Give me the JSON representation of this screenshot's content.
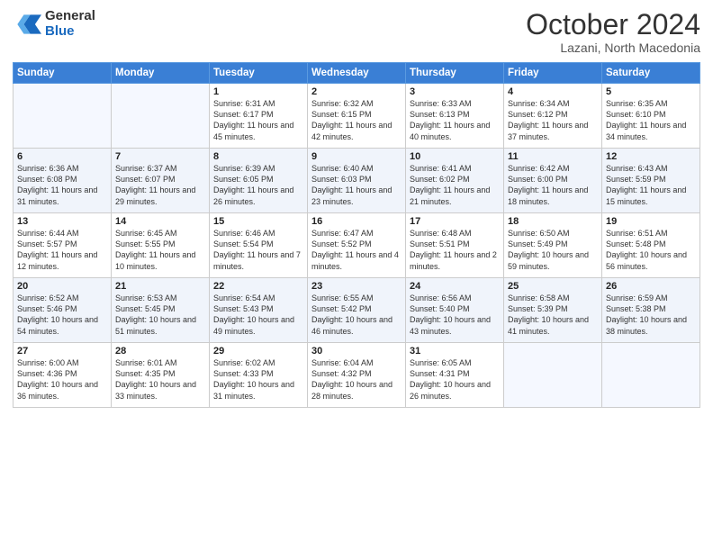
{
  "header": {
    "logo_general": "General",
    "logo_blue": "Blue",
    "month_title": "October 2024",
    "location": "Lazani, North Macedonia"
  },
  "weekdays": [
    "Sunday",
    "Monday",
    "Tuesday",
    "Wednesday",
    "Thursday",
    "Friday",
    "Saturday"
  ],
  "weeks": [
    [
      {
        "day": "",
        "info": ""
      },
      {
        "day": "",
        "info": ""
      },
      {
        "day": "1",
        "info": "Sunrise: 6:31 AM\nSunset: 6:17 PM\nDaylight: 11 hours and 45 minutes."
      },
      {
        "day": "2",
        "info": "Sunrise: 6:32 AM\nSunset: 6:15 PM\nDaylight: 11 hours and 42 minutes."
      },
      {
        "day": "3",
        "info": "Sunrise: 6:33 AM\nSunset: 6:13 PM\nDaylight: 11 hours and 40 minutes."
      },
      {
        "day": "4",
        "info": "Sunrise: 6:34 AM\nSunset: 6:12 PM\nDaylight: 11 hours and 37 minutes."
      },
      {
        "day": "5",
        "info": "Sunrise: 6:35 AM\nSunset: 6:10 PM\nDaylight: 11 hours and 34 minutes."
      }
    ],
    [
      {
        "day": "6",
        "info": "Sunrise: 6:36 AM\nSunset: 6:08 PM\nDaylight: 11 hours and 31 minutes."
      },
      {
        "day": "7",
        "info": "Sunrise: 6:37 AM\nSunset: 6:07 PM\nDaylight: 11 hours and 29 minutes."
      },
      {
        "day": "8",
        "info": "Sunrise: 6:39 AM\nSunset: 6:05 PM\nDaylight: 11 hours and 26 minutes."
      },
      {
        "day": "9",
        "info": "Sunrise: 6:40 AM\nSunset: 6:03 PM\nDaylight: 11 hours and 23 minutes."
      },
      {
        "day": "10",
        "info": "Sunrise: 6:41 AM\nSunset: 6:02 PM\nDaylight: 11 hours and 21 minutes."
      },
      {
        "day": "11",
        "info": "Sunrise: 6:42 AM\nSunset: 6:00 PM\nDaylight: 11 hours and 18 minutes."
      },
      {
        "day": "12",
        "info": "Sunrise: 6:43 AM\nSunset: 5:59 PM\nDaylight: 11 hours and 15 minutes."
      }
    ],
    [
      {
        "day": "13",
        "info": "Sunrise: 6:44 AM\nSunset: 5:57 PM\nDaylight: 11 hours and 12 minutes."
      },
      {
        "day": "14",
        "info": "Sunrise: 6:45 AM\nSunset: 5:55 PM\nDaylight: 11 hours and 10 minutes."
      },
      {
        "day": "15",
        "info": "Sunrise: 6:46 AM\nSunset: 5:54 PM\nDaylight: 11 hours and 7 minutes."
      },
      {
        "day": "16",
        "info": "Sunrise: 6:47 AM\nSunset: 5:52 PM\nDaylight: 11 hours and 4 minutes."
      },
      {
        "day": "17",
        "info": "Sunrise: 6:48 AM\nSunset: 5:51 PM\nDaylight: 11 hours and 2 minutes."
      },
      {
        "day": "18",
        "info": "Sunrise: 6:50 AM\nSunset: 5:49 PM\nDaylight: 10 hours and 59 minutes."
      },
      {
        "day": "19",
        "info": "Sunrise: 6:51 AM\nSunset: 5:48 PM\nDaylight: 10 hours and 56 minutes."
      }
    ],
    [
      {
        "day": "20",
        "info": "Sunrise: 6:52 AM\nSunset: 5:46 PM\nDaylight: 10 hours and 54 minutes."
      },
      {
        "day": "21",
        "info": "Sunrise: 6:53 AM\nSunset: 5:45 PM\nDaylight: 10 hours and 51 minutes."
      },
      {
        "day": "22",
        "info": "Sunrise: 6:54 AM\nSunset: 5:43 PM\nDaylight: 10 hours and 49 minutes."
      },
      {
        "day": "23",
        "info": "Sunrise: 6:55 AM\nSunset: 5:42 PM\nDaylight: 10 hours and 46 minutes."
      },
      {
        "day": "24",
        "info": "Sunrise: 6:56 AM\nSunset: 5:40 PM\nDaylight: 10 hours and 43 minutes."
      },
      {
        "day": "25",
        "info": "Sunrise: 6:58 AM\nSunset: 5:39 PM\nDaylight: 10 hours and 41 minutes."
      },
      {
        "day": "26",
        "info": "Sunrise: 6:59 AM\nSunset: 5:38 PM\nDaylight: 10 hours and 38 minutes."
      }
    ],
    [
      {
        "day": "27",
        "info": "Sunrise: 6:00 AM\nSunset: 4:36 PM\nDaylight: 10 hours and 36 minutes."
      },
      {
        "day": "28",
        "info": "Sunrise: 6:01 AM\nSunset: 4:35 PM\nDaylight: 10 hours and 33 minutes."
      },
      {
        "day": "29",
        "info": "Sunrise: 6:02 AM\nSunset: 4:33 PM\nDaylight: 10 hours and 31 minutes."
      },
      {
        "day": "30",
        "info": "Sunrise: 6:04 AM\nSunset: 4:32 PM\nDaylight: 10 hours and 28 minutes."
      },
      {
        "day": "31",
        "info": "Sunrise: 6:05 AM\nSunset: 4:31 PM\nDaylight: 10 hours and 26 minutes."
      },
      {
        "day": "",
        "info": ""
      },
      {
        "day": "",
        "info": ""
      }
    ]
  ]
}
